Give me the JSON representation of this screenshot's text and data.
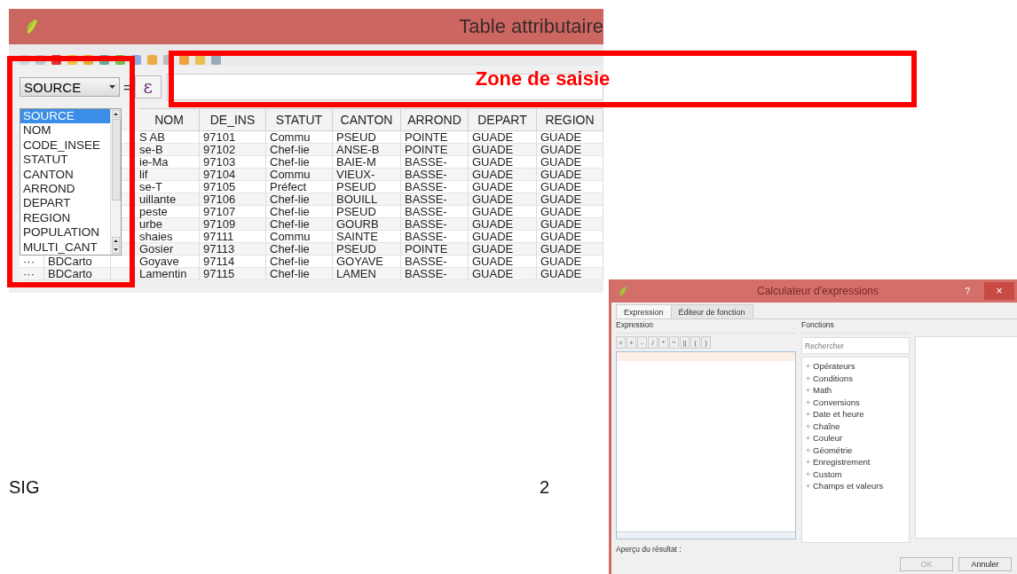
{
  "attribute_table_window": {
    "title": "Table attributaire",
    "field_combo": {
      "value": "SOURCE"
    },
    "operator": "=",
    "expression_button": "ε",
    "field_list": [
      {
        "label": "SOURCE",
        "selected": true
      },
      {
        "label": "NOM",
        "selected": false
      },
      {
        "label": "CODE_INSEE",
        "selected": false
      },
      {
        "label": "STATUT",
        "selected": false
      },
      {
        "label": "CANTON",
        "selected": false
      },
      {
        "label": "ARROND",
        "selected": false
      },
      {
        "label": "DEPART",
        "selected": false
      },
      {
        "label": "REGION",
        "selected": false
      },
      {
        "label": "POPULATION",
        "selected": false
      },
      {
        "label": "MULTI_CANT",
        "selected": false
      }
    ],
    "columns": [
      "NOM",
      "DE_INS",
      "STATUT",
      "CANTON",
      "ARROND",
      "DEPART",
      "REGION"
    ],
    "rows": [
      {
        "cells": [
          "S AB",
          "97101",
          "Commu",
          "PSEUD",
          "POINTE",
          "GUADE",
          "GUADE"
        ]
      },
      {
        "cells": [
          "se-B",
          "97102",
          "Chef-lie",
          "ANSE-B",
          "POINTE",
          "GUADE",
          "GUADE"
        ]
      },
      {
        "cells": [
          "ie-Ma",
          "97103",
          "Chef-lie",
          "BAIE-M",
          "BASSE-",
          "GUADE",
          "GUADE"
        ]
      },
      {
        "cells": [
          "lif",
          "97104",
          "Commu",
          "VIEUX-",
          "BASSE-",
          "GUADE",
          "GUADE"
        ]
      },
      {
        "cells": [
          "se-T",
          "97105",
          "Préfect",
          "PSEUD",
          "BASSE-",
          "GUADE",
          "GUADE"
        ]
      },
      {
        "cells": [
          "uillante",
          "97106",
          "Chef-lie",
          "BOUILL",
          "BASSE-",
          "GUADE",
          "GUADE"
        ]
      },
      {
        "cells": [
          "peste",
          "97107",
          "Chef-lie",
          "PSEUD",
          "BASSE-",
          "GUADE",
          "GUADE"
        ]
      },
      {
        "cells": [
          "urbe",
          "97109",
          "Chef-lie",
          "GOURB",
          "BASSE-",
          "GUADE",
          "GUADE"
        ]
      },
      {
        "cells": [
          "shaies",
          "97111",
          "Commu",
          "SAINTE",
          "BASSE-",
          "GUADE",
          "GUADE"
        ]
      },
      {
        "cells": [
          "Gosier",
          "97113",
          "Chef-lie",
          "PSEUD",
          "POINTE",
          "GUADE",
          "GUADE"
        ]
      },
      {
        "handle": "···",
        "source": "BDCarto",
        "cells": [
          "Goyave",
          "97114",
          "Chef-lie",
          "GOYAVE",
          "BASSE-",
          "GUADE",
          "GUADE"
        ]
      },
      {
        "handle": "···",
        "source": "BDCarto",
        "cells": [
          "Lamentin",
          "97115",
          "Chef-lie",
          "LAMEN",
          "BASSE-",
          "GUADE",
          "GUADE"
        ]
      }
    ]
  },
  "expression_dialog": {
    "title": "Calculateur d'expressions",
    "help": "?",
    "close": "×",
    "tabs": [
      {
        "label": "Expression",
        "selected": true
      },
      {
        "label": "Éditeur de fonction",
        "selected": false
      }
    ],
    "expression_label": "Expression",
    "operators": [
      "=",
      "+",
      "-",
      "/",
      "*",
      "^",
      "||",
      "(",
      ")"
    ],
    "functions_label": "Fonctions",
    "search": {
      "placeholder": "Rechercher"
    },
    "functions": [
      "Opérateurs",
      "Conditions",
      "Math",
      "Conversions",
      "Date et heure",
      "Chaîne",
      "Couleur",
      "Géométrie",
      "Enregistrement",
      "Custom",
      "Champs et valeurs"
    ],
    "preview_label": "Aperçu du résultat :",
    "buttons": [
      {
        "label": "OK",
        "disabled": true
      },
      {
        "label": "Annuler",
        "disabled": false
      }
    ]
  },
  "annotations": [
    {
      "kind": "frame"
    },
    {
      "kind": "labeled_frame",
      "label": "Zone de saisie"
    }
  ],
  "document": {
    "footer_left": "SIG",
    "page_number": "2"
  }
}
